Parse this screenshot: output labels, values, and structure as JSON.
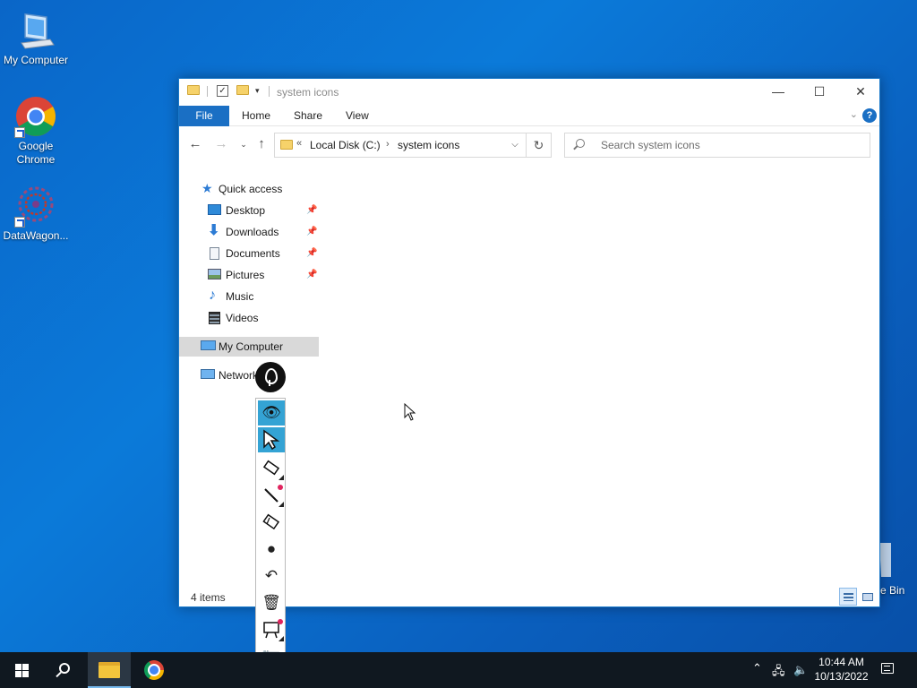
{
  "desktop": {
    "icons": [
      {
        "label": "My Computer"
      },
      {
        "label": "Google Chrome"
      },
      {
        "label": "DataWagon..."
      }
    ],
    "recycle_bin_label": "e Bin"
  },
  "explorer": {
    "title": "system icons",
    "ribbon_tabs": [
      "File",
      "Home",
      "Share",
      "View"
    ],
    "help_label": "?",
    "address_prefix": "«",
    "address_segments": [
      "Local Disk (C:)",
      "system icons"
    ],
    "search_placeholder": "Search system icons",
    "nav": {
      "quick_access": "Quick access",
      "pinned": [
        "Desktop",
        "Downloads",
        "Documents",
        "Pictures"
      ],
      "unpinned": [
        "Music",
        "Videos"
      ],
      "my_computer": "My Computer",
      "network": "Network"
    },
    "status": "4 items"
  },
  "taskbar": {
    "time": "10:44 AM",
    "date": "10/13/2022"
  }
}
